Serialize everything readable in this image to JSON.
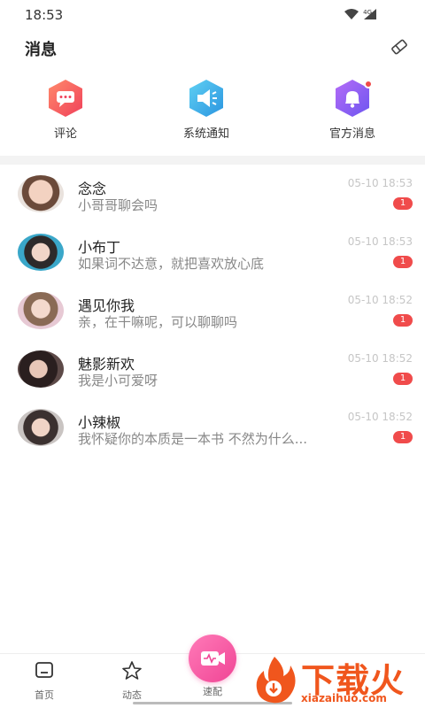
{
  "status_bar": {
    "time": "18:53",
    "network": "4G"
  },
  "header": {
    "title": "消息"
  },
  "quick_actions": [
    {
      "label": "评论",
      "icon": "comment-icon",
      "color": "#f3574f"
    },
    {
      "label": "系统通知",
      "icon": "megaphone-icon",
      "color": "#3bb2e8"
    },
    {
      "label": "官方消息",
      "icon": "bell-icon",
      "color": "#8a5cf5",
      "has_dot": true
    }
  ],
  "messages": [
    {
      "name": "念念",
      "preview": "小哥哥聊会吗",
      "time": "05-10 18:53",
      "unread": "1"
    },
    {
      "name": "小布丁",
      "preview": "如果词不达意，就把喜欢放心底",
      "time": "05-10 18:53",
      "unread": "1"
    },
    {
      "name": "遇见你我",
      "preview": "亲，在干嘛呢，可以聊聊吗",
      "time": "05-10 18:52",
      "unread": "1"
    },
    {
      "name": "魅影新欢",
      "preview": "我是小可爱呀",
      "time": "05-10 18:52",
      "unread": "1"
    },
    {
      "name": "小辣椒",
      "preview": "我怀疑你的本质是一本书 不然为什么...",
      "time": "05-10 18:52",
      "unread": "1"
    }
  ],
  "tabbar": {
    "home": "首页",
    "moments": "动态",
    "match": "速配"
  },
  "watermark": {
    "title": "下载火",
    "url": "xiazaihuo.com"
  },
  "colors": {
    "badge": "#f04b4b",
    "accent": "#f04595",
    "watermark": "#f0561d"
  }
}
